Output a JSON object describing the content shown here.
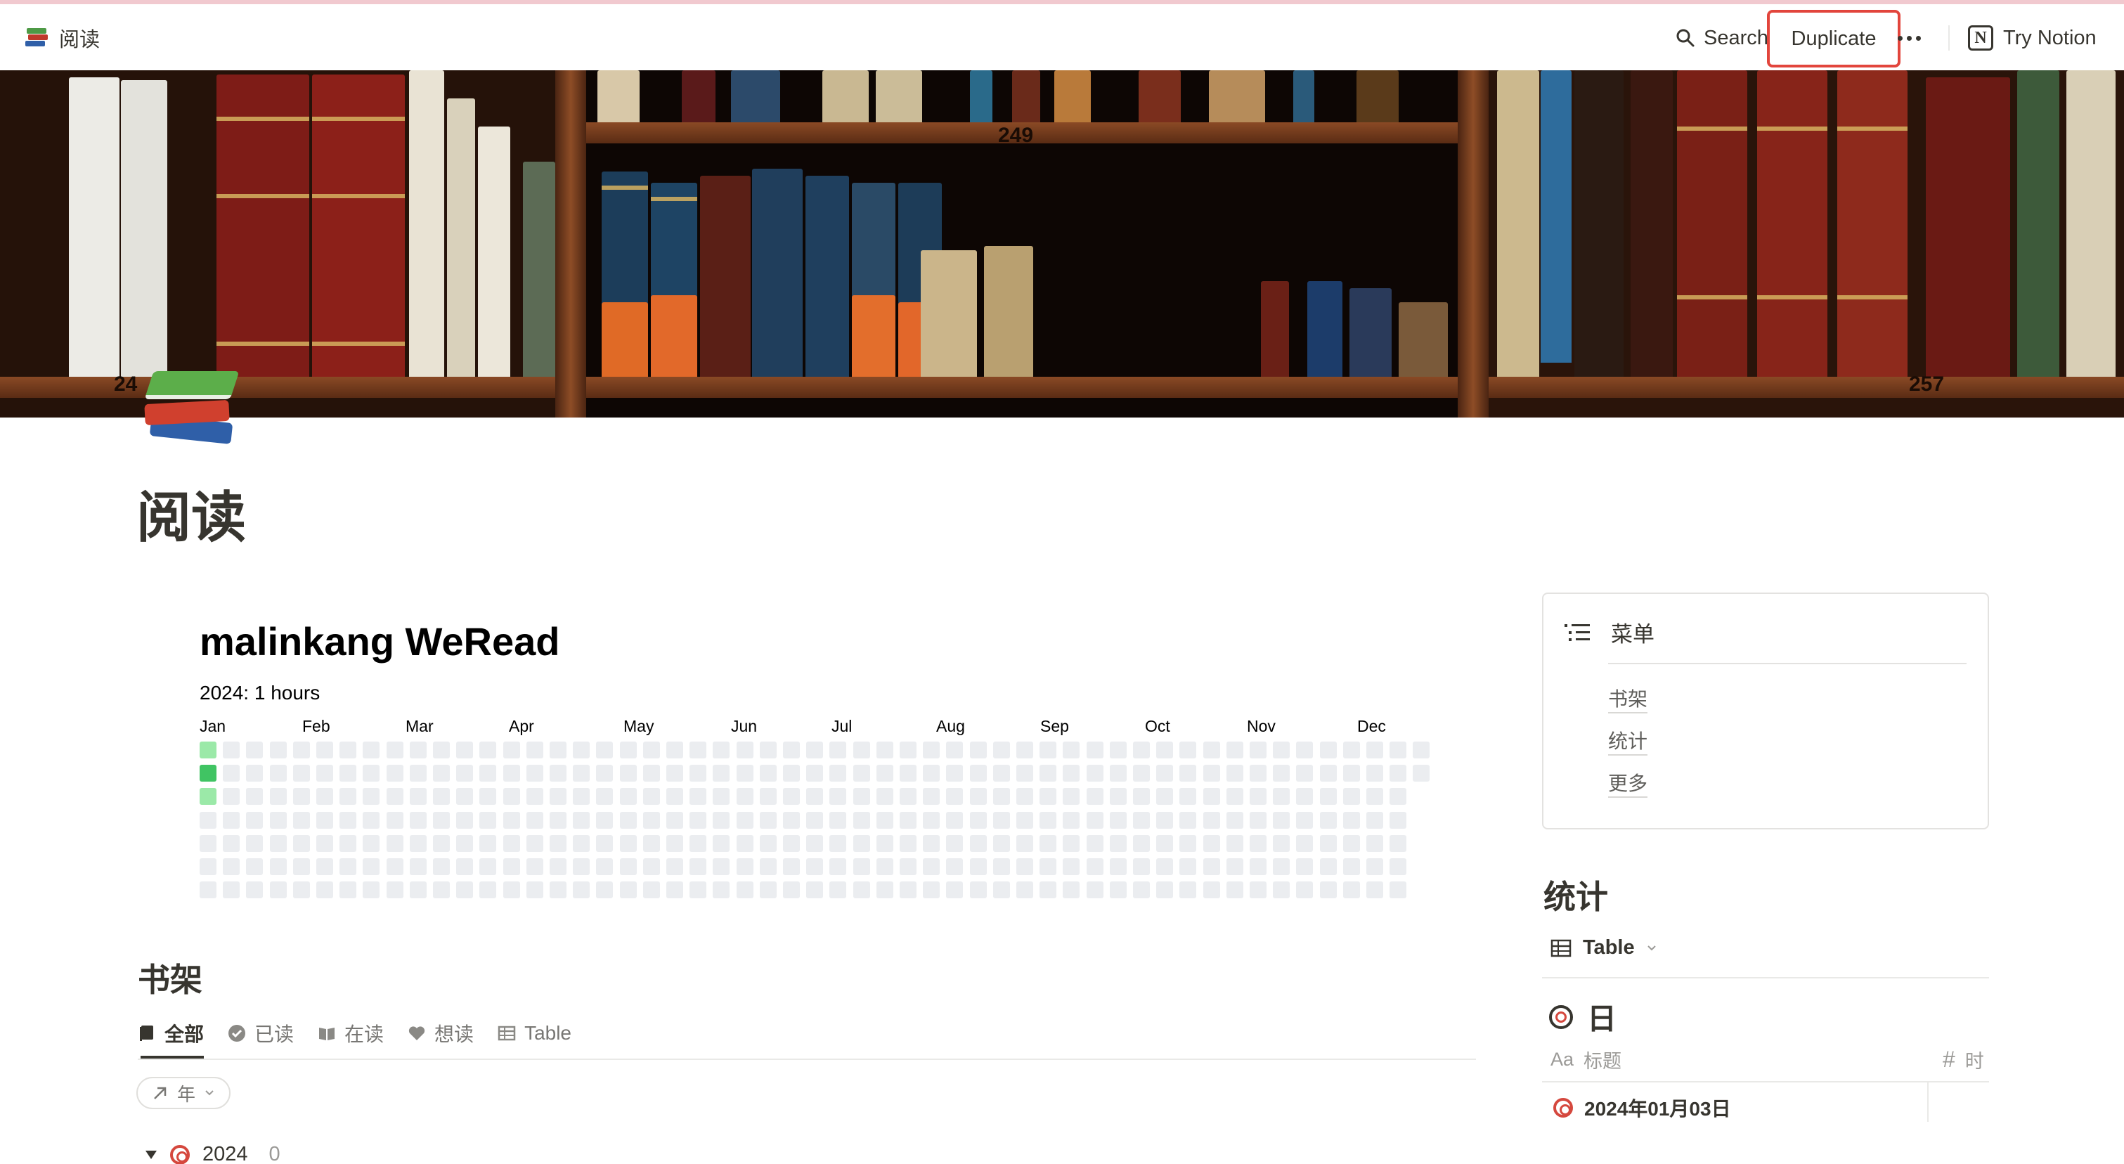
{
  "topbar": {
    "page_name": "阅读",
    "search_label": "Search",
    "duplicate_label": "Duplicate",
    "try_label": "Try Notion"
  },
  "cover": {
    "shelf_numbers": [
      "249",
      "24",
      "257"
    ]
  },
  "page": {
    "title": "阅读"
  },
  "heatmap": {
    "title": "malinkang WeRead",
    "subtitle": "2024: 1 hours",
    "months": [
      "Jan",
      "Feb",
      "Mar",
      "Apr",
      "May",
      "Jun",
      "Jul",
      "Aug",
      "Sep",
      "Oct",
      "Nov",
      "Dec"
    ],
    "active_days": [
      {
        "week": 0,
        "weekday": 0,
        "level": 1
      },
      {
        "week": 0,
        "weekday": 1,
        "level": 2
      },
      {
        "week": 0,
        "weekday": 2,
        "level": 1
      }
    ],
    "colors": {
      "empty": "#ebedf0",
      "level1": "#9be9a8",
      "level2": "#40c463"
    }
  },
  "shelf": {
    "title": "书架",
    "tabs": [
      {
        "label": "全部",
        "icon": "book-icon",
        "active": true
      },
      {
        "label": "已读",
        "icon": "check-circle-icon",
        "active": false
      },
      {
        "label": "在读",
        "icon": "open-book-icon",
        "active": false
      },
      {
        "label": "想读",
        "icon": "heart-icon",
        "active": false
      },
      {
        "label": "Table",
        "icon": "table-icon",
        "active": false
      }
    ],
    "group_by_label": "年",
    "group": {
      "label": "2024",
      "count": "0"
    }
  },
  "menu": {
    "title": "菜单",
    "links": [
      "书架",
      "统计",
      "更多"
    ]
  },
  "stats": {
    "title": "统计",
    "view_label": "Table",
    "sub_title": "日",
    "columns": [
      {
        "icon": "text-type-icon",
        "label": "标题",
        "prefix": "Aa"
      },
      {
        "icon": "number-icon",
        "label": "时",
        "prefix": "#"
      }
    ],
    "rows": [
      {
        "title": "2024年01月03日"
      }
    ]
  },
  "colors": {
    "accent_red": "#e2453c",
    "text": "#37352f",
    "muted": "#787774"
  }
}
